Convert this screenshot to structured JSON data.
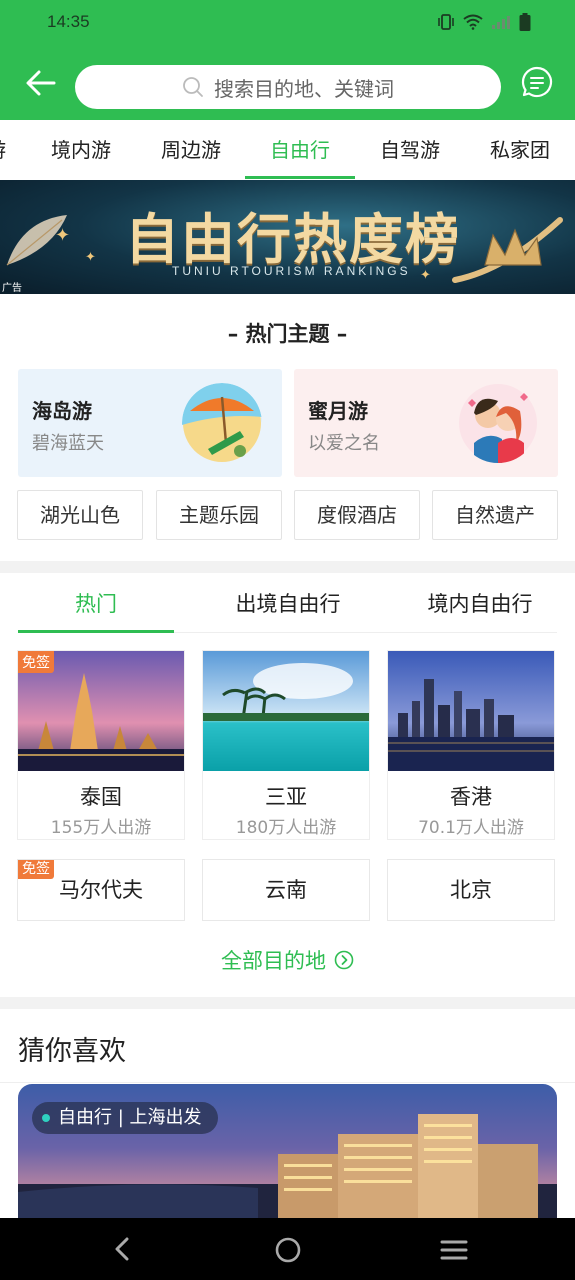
{
  "status": {
    "time": "14:35"
  },
  "header": {
    "search_placeholder": "搜索目的地、关键词"
  },
  "tabs": [
    "境内游",
    "周边游",
    "自由行",
    "自驾游",
    "私家团"
  ],
  "tab_partial": "游",
  "active_tab": "自由行",
  "banner": {
    "title": "自由行热度榜",
    "subtitle": "TUNIU  RTOURISM  RANKINGS",
    "ad": "广告"
  },
  "hot_themes": {
    "title": "– 热门主题 –",
    "cards": [
      {
        "name": "海岛游",
        "desc": "碧海蓝天",
        "bg": "#eaf3fb"
      },
      {
        "name": "蜜月游",
        "desc": "以爱之名",
        "bg": "#fcefef"
      }
    ],
    "tags": [
      "湖光山色",
      "主题乐园",
      "度假酒店",
      "自然遗产"
    ]
  },
  "destinations": {
    "tabs": [
      "热门",
      "出境自由行",
      "境内自由行"
    ],
    "active_tab": "热门",
    "cards": [
      {
        "name": "泰国",
        "count": "155万人出游",
        "badge": "免签"
      },
      {
        "name": "三亚",
        "count": "180万人出游",
        "badge": ""
      },
      {
        "name": "香港",
        "count": "70.1万人出游",
        "badge": ""
      }
    ],
    "more": [
      {
        "name": "马尔代夫",
        "badge": "免签"
      },
      {
        "name": "云南",
        "badge": ""
      },
      {
        "name": "北京",
        "badge": ""
      }
    ],
    "all_link": "全部目的地"
  },
  "guess": {
    "title": "猜你喜欢",
    "card_tag": "自由行 | 上海出发"
  },
  "colors": {
    "brand": "#2fbd52",
    "badge": "#f07a3a"
  }
}
